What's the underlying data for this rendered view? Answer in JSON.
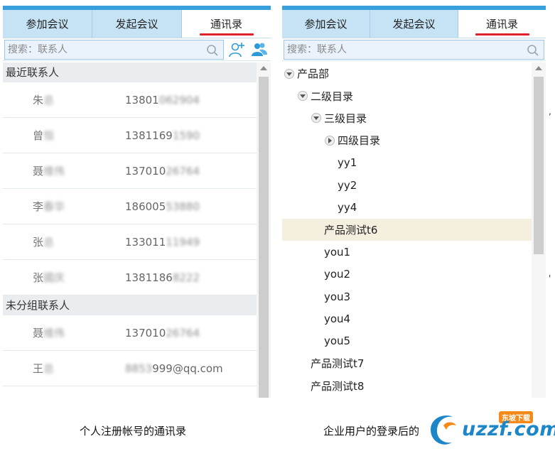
{
  "left": {
    "tabs": [
      "参加会议",
      "发起会议",
      "通讯录"
    ],
    "search_placeholder": "搜索：联系人",
    "groups": [
      {
        "label": "最近联系人",
        "contacts": [
          {
            "name_head": "朱",
            "name_tail": "总",
            "phone_head": "13801",
            "phone_tail": "062904"
          },
          {
            "name_head": "曾",
            "name_tail": "恒",
            "phone_head": "1381169",
            "phone_tail": "1590"
          },
          {
            "name_head": "聂",
            "name_tail": "维伟",
            "phone_head": "137010",
            "phone_tail": "26764"
          },
          {
            "name_head": "李",
            "name_tail": "春华",
            "phone_head": "186005",
            "phone_tail": "53880"
          },
          {
            "name_head": "张",
            "name_tail": "总",
            "phone_head": "133011",
            "phone_tail": "11949"
          },
          {
            "name_head": "张",
            "name_tail": "國庆",
            "phone_head": "1381186",
            "phone_tail": "8222"
          }
        ]
      },
      {
        "label": "未分组联系人",
        "contacts": [
          {
            "name_head": "聂",
            "name_tail": "维伟",
            "phone_head": "137010",
            "phone_tail": "26764"
          },
          {
            "name_head": "王",
            "name_tail": "总",
            "phone_head": "",
            "phone_tail": "8853",
            "phone_suffix": "999@qq.com",
            "email": true
          }
        ]
      }
    ]
  },
  "right": {
    "tabs": [
      "参加会议",
      "发起会议",
      "通讯录"
    ],
    "search_placeholder": "搜索：联系人",
    "tree": [
      {
        "label": "产品部",
        "depth": 0,
        "toggle": "expanded"
      },
      {
        "label": "二级目录",
        "depth": 1,
        "toggle": "expanded"
      },
      {
        "label": "三级目录",
        "depth": 2,
        "toggle": "expanded"
      },
      {
        "label": "四级目录",
        "depth": 3,
        "toggle": "collapsed"
      },
      {
        "label": "yy1",
        "depth": 3,
        "toggle": "none"
      },
      {
        "label": "yy2",
        "depth": 3,
        "toggle": "none"
      },
      {
        "label": "yy4",
        "depth": 3,
        "toggle": "none"
      },
      {
        "label": "产品测试t6",
        "depth": 2,
        "toggle": "none",
        "selected": true
      },
      {
        "label": "you1",
        "depth": 2,
        "toggle": "none"
      },
      {
        "label": "you2",
        "depth": 2,
        "toggle": "none"
      },
      {
        "label": "you3",
        "depth": 2,
        "toggle": "none"
      },
      {
        "label": "you4",
        "depth": 2,
        "toggle": "none"
      },
      {
        "label": "you5",
        "depth": 2,
        "toggle": "none"
      },
      {
        "label": "产品测试t7",
        "depth": 1,
        "toggle": "none"
      },
      {
        "label": "产品测试t8",
        "depth": 1,
        "toggle": "none"
      }
    ]
  },
  "captions": {
    "left": "个人注册帐号的通讯录",
    "right": "企业用户的登录后的"
  },
  "watermark": {
    "text": "uzzf.com",
    "badge": "东坡下载"
  },
  "colors": {
    "accent": "#3aa0dd",
    "tab_bg": "#c6e3f5",
    "active_underline": "#e0212b",
    "selected_row": "#f5efdf"
  },
  "icons": [
    "search-icon",
    "add-contact-icon",
    "group-contacts-icon",
    "expand-icon",
    "collapse-icon"
  ]
}
